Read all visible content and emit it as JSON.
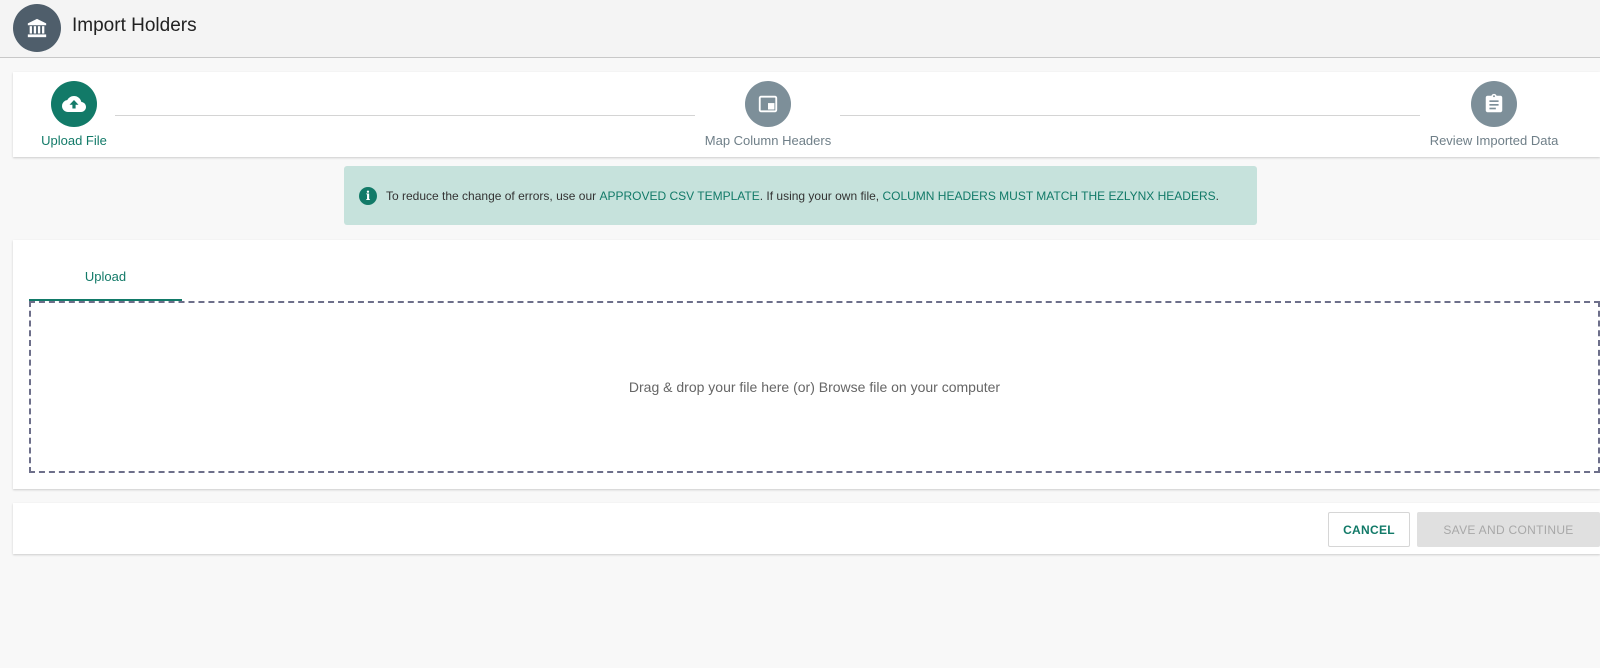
{
  "header": {
    "title": "Import Holders",
    "logo_icon": "bank-icon"
  },
  "stepper": {
    "steps": [
      {
        "label": "Upload File",
        "icon": "cloud-upload-icon",
        "state": "active"
      },
      {
        "label": "Map Column Headers",
        "icon": "window-icon",
        "state": "inactive"
      },
      {
        "label": "Review Imported Data",
        "icon": "clipboard-icon",
        "state": "inactive"
      }
    ]
  },
  "banner": {
    "icon": "info-icon",
    "text_1": "To reduce the change of errors, use our ",
    "link_1": "APPROVED CSV TEMPLATE",
    "text_2": ". If using your own file, ",
    "link_2": "COLUMN HEADERS MUST MATCH THE EZLYNX HEADERS",
    "text_3": "."
  },
  "upload": {
    "tab_label": "Upload",
    "dropzone_text": "Drag & drop your file here (or) Browse file on your computer"
  },
  "actions": {
    "cancel_label": "CANCEL",
    "save_label": "SAVE AND CONTINUE"
  },
  "colors": {
    "accent": "#127a68",
    "inactive_step": "#7d8f99",
    "banner_bg": "#c6e2dc",
    "header_logo_bg": "#4f5e6b"
  }
}
